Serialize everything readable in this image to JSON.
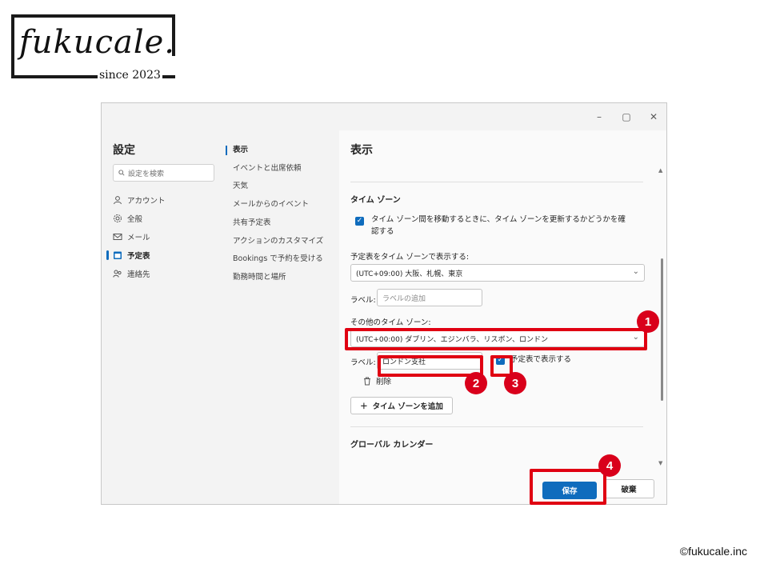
{
  "logo": {
    "wordmark": "fukucale.",
    "since": "since 2023"
  },
  "window": {
    "controls": {
      "minimize": "–",
      "maximize": "▢",
      "close": "✕"
    },
    "sidebar": {
      "title": "設定",
      "search_placeholder": "設定を検索",
      "items": [
        {
          "label": "アカウント",
          "icon": "person-icon"
        },
        {
          "label": "全般",
          "icon": "gear-icon"
        },
        {
          "label": "メール",
          "icon": "mail-icon"
        },
        {
          "label": "予定表",
          "icon": "calendar-icon",
          "active": true
        },
        {
          "label": "連絡先",
          "icon": "people-icon"
        }
      ]
    },
    "subnav": {
      "items": [
        {
          "label": "表示",
          "active": true
        },
        {
          "label": "イベントと出席依頼"
        },
        {
          "label": "天気"
        },
        {
          "label": "メールからのイベント"
        },
        {
          "label": "共有予定表"
        },
        {
          "label": "アクションのカスタマイズ"
        },
        {
          "label": "Bookings で予約を受ける"
        },
        {
          "label": "勤務時間と場所"
        }
      ]
    },
    "main": {
      "title": "表示",
      "timezone_section": "タイム ゾーン",
      "update_tz_checkbox_line1": "タイム ゾーン間を移動するときに、タイム ゾーンを更新するかどうかを確",
      "update_tz_checkbox_line2": "認する",
      "display_tz_label": "予定表をタイム ゾーンで表示する:",
      "display_tz_value": "(UTC+09:00) 大阪、札幌、東京",
      "label1_label": "ラベル:",
      "label1_placeholder": "ラベルの追加",
      "other_tz_label": "その他のタイム ゾーン:",
      "other_tz_value": "(UTC+00:00) ダブリン、エジンバラ、リスボン、ロンドン",
      "label2_label": "ラベル:",
      "label2_value": "ロンドン支社",
      "show_in_calendar": "予定表で表示する",
      "delete": "削除",
      "add_timezone": "タイム ゾーンを追加",
      "global_calendar": "グローバル カレンダー",
      "save": "保存",
      "discard": "破棄"
    }
  },
  "annotations": [
    "1",
    "2",
    "3",
    "4"
  ],
  "annotation_color": "#e00012",
  "accent_color": "#0f6cbd",
  "copyright": "©fukucale.inc"
}
